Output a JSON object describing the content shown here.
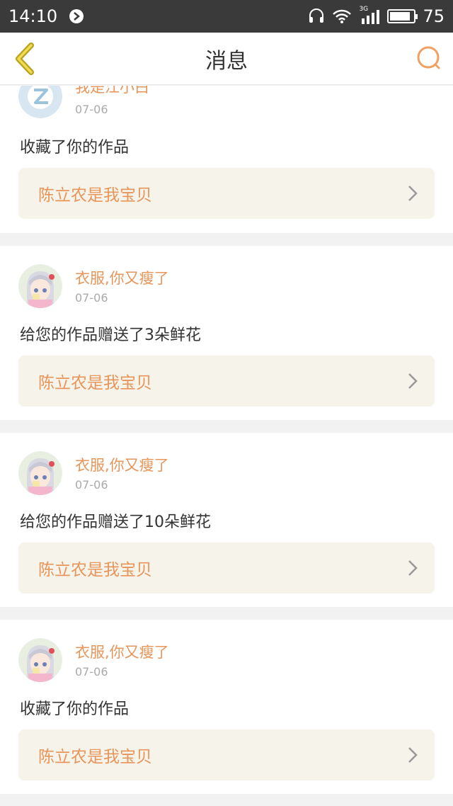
{
  "status_bar": {
    "time": "14:10",
    "network": "3G",
    "battery": "75"
  },
  "nav": {
    "title": "消息"
  },
  "messages": [
    {
      "user": "我是江小白",
      "date": "07-06",
      "text": "收藏了你的作品",
      "work": "陈立农是我宝贝"
    },
    {
      "user": "衣服,你又瘦了",
      "date": "07-06",
      "text": "给您的作品赠送了3朵鲜花",
      "work": "陈立农是我宝贝"
    },
    {
      "user": "衣服,你又瘦了",
      "date": "07-06",
      "text": "给您的作品赠送了10朵鲜花",
      "work": "陈立农是我宝贝"
    },
    {
      "user": "衣服,你又瘦了",
      "date": "07-06",
      "text": "收藏了你的作品",
      "work": "陈立农是我宝贝"
    }
  ],
  "colors": {
    "accent": "#e8955a",
    "status_bar": "#3a3a3a",
    "card_link_bg": "#f5f3ea"
  }
}
